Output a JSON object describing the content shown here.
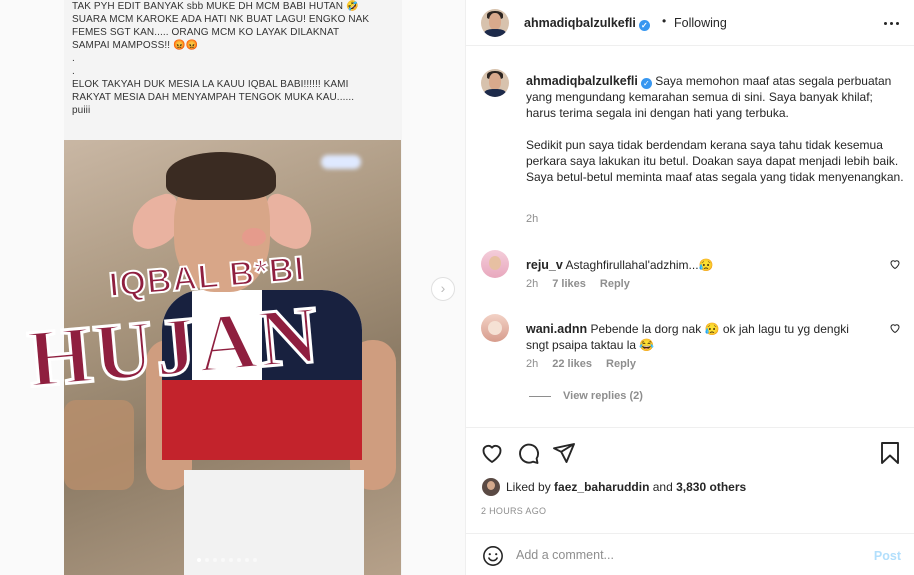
{
  "media": {
    "caption_lines": [
      "TAK PYH EDIT BANYAK sbb MUKE DH MCM BABI HUTAN 🤣",
      "SUARA MCM KAROKE ADA HATI NK BUAT LAGU! ENGKO NAK",
      "FEMES SGT KAN..... ORANG MCM KO LAYAK DILAKNAT",
      "SAMPAI MAMPOSS!! 😡😡",
      ".",
      ".",
      "ELOK TAKYAH DUK MESIA LA KAUU IQBAL BABI!!!!!! KAMI",
      "RAKYAT MESIA DAH MENYAMPAH TENGOK MUKA KAU......",
      "puiii"
    ],
    "overlay_small": "IQBAL B*BI",
    "overlay_big": "HUJAN",
    "slide_count": 8,
    "active_slide": 0,
    "next_glyph": "›"
  },
  "header": {
    "username": "ahmadiqbalzulkefli",
    "separator": "•",
    "follow_state": "Following"
  },
  "caption": {
    "username": "ahmadiqbalzulkefli",
    "paragraph1": "Saya memohon maaf atas segala perbuatan yang mengundang kemarahan semua di sini. Saya banyak khilaf; harus terima segala ini dengan hati yang terbuka.",
    "paragraph2": "Sedikit pun saya tidak berdendam kerana saya tahu tidak kesemua perkara saya lakukan itu betul. Doakan saya dapat menjadi lebih baik. Saya betul-betul meminta maaf atas segala yang tidak menyenangkan.",
    "time": "2h"
  },
  "comments": [
    {
      "username": "reju_v",
      "text": "Astaghfirullahal'adzhim...😥",
      "time": "2h",
      "likes": "7 likes",
      "reply": "Reply"
    },
    {
      "username": "wani.adnn",
      "text": "Pebende la dorg nak 😥 ok jah lagu tu yg dengki sngt psaipa taktau la 😂",
      "time": "2h",
      "likes": "22 likes",
      "reply": "Reply"
    }
  ],
  "view_replies": "View replies (2)",
  "likes": {
    "prefix": "Liked by",
    "user": "faez_baharuddin",
    "middle": "and",
    "others": "3,830 others"
  },
  "posted_ago": "2 HOURS AGO",
  "add_comment": {
    "placeholder": "Add a comment...",
    "post_label": "Post"
  },
  "colors": {
    "verified": "#3897f0",
    "post_button_disabled": "#b2dffc",
    "overlay_text": "#8f1f3f"
  }
}
